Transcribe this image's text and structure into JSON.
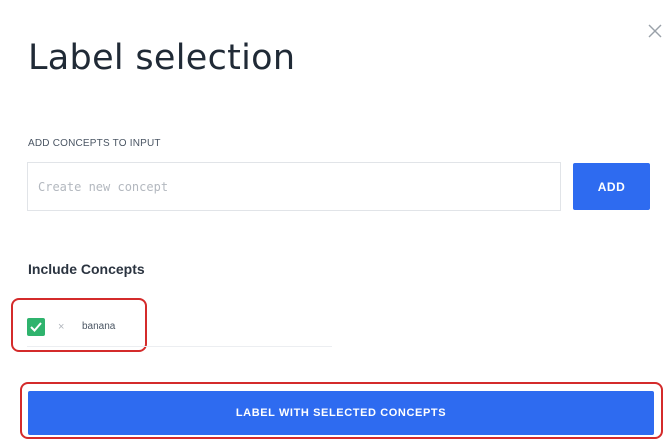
{
  "dialog": {
    "title": "Label selection",
    "close_icon": "close-icon"
  },
  "add_concepts": {
    "section_label": "ADD CONCEPTS TO INPUT",
    "input_placeholder": "Create new concept",
    "input_value": "",
    "add_button_label": "ADD"
  },
  "include_concepts": {
    "heading": "Include Concepts",
    "items": [
      {
        "name": "banana",
        "checked": true,
        "check_icon": "checkmark-icon",
        "remove_icon": "remove-icon",
        "remove_glyph": "×"
      }
    ]
  },
  "submit": {
    "label": "LABEL WITH SELECTED CONCEPTS"
  },
  "colors": {
    "primary": "#2e6bf0",
    "checkbox": "#2fb36d",
    "highlight": "#d42b2b",
    "title": "#202a36"
  }
}
